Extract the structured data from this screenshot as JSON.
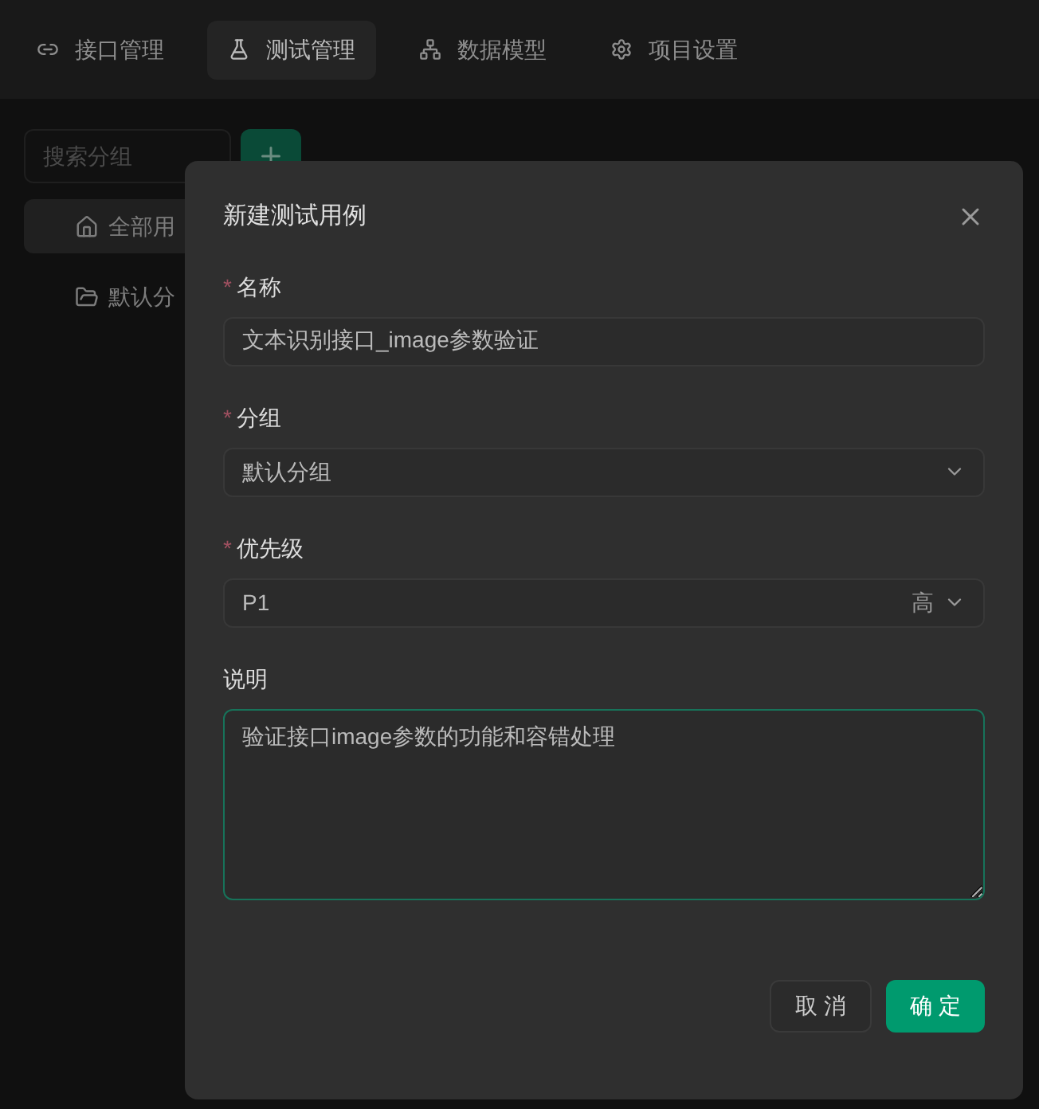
{
  "nav_tabs": [
    {
      "label": "接口管理",
      "selected": false
    },
    {
      "label": "测试管理",
      "selected": true
    },
    {
      "label": "数据模型",
      "selected": false
    },
    {
      "label": "项目设置",
      "selected": false
    }
  ],
  "sidebar": {
    "search": {
      "placeholder": "搜索分组"
    },
    "items": [
      {
        "label": "全部用",
        "selected": true
      },
      {
        "label": "默认分",
        "selected": false
      }
    ]
  },
  "dialog": {
    "title": "新建测试用例",
    "fields": [
      {
        "kind": "input",
        "label": "名称",
        "required_mark": "*",
        "value": "文本识别接口_image参数验证"
      },
      {
        "kind": "select",
        "label": "分组",
        "required_mark": "*",
        "value": "默认分组"
      },
      {
        "kind": "select",
        "label": "优先级",
        "required_mark": "*",
        "value": "P1",
        "suffix": "高"
      },
      {
        "kind": "textarea",
        "label": "说明",
        "value": "验证接口image参数的功能和容错处理",
        "focused": true
      }
    ],
    "buttons": [
      {
        "label": "取 消",
        "kind": "secondary"
      },
      {
        "label": "确 定",
        "kind": "primary"
      }
    ]
  }
}
